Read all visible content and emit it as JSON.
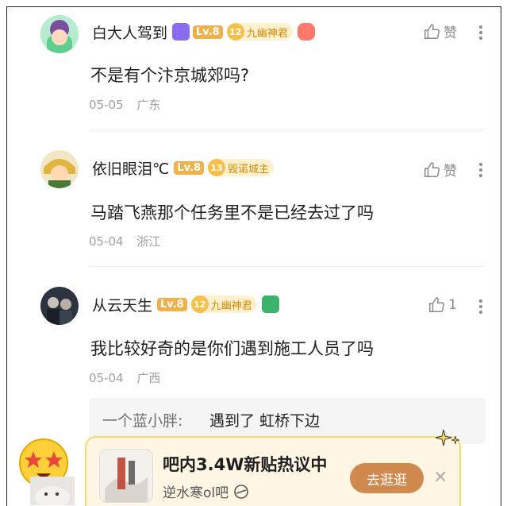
{
  "comments": [
    {
      "username": "白大人驾到",
      "level": "Lv.8",
      "rank_num": "12",
      "rank_title": "九幽神君",
      "like_label": "赞",
      "content": "不是有个汴京城郊吗?",
      "date": "05-05",
      "location": "广东"
    },
    {
      "username": "依旧眼泪℃",
      "level": "Lv.8",
      "rank_num": "13",
      "rank_title": "毁诺城主",
      "like_label": "赞",
      "content": "马踏飞燕那个任务里不是已经去过了吗",
      "date": "05-04",
      "location": "浙江"
    },
    {
      "username": "从云天生",
      "level": "Lv.8",
      "rank_num": "12",
      "rank_title": "九幽神君",
      "like_label": "1",
      "content": "我比较好奇的是你们遇到施工人员了吗",
      "date": "05-04",
      "location": "广西"
    }
  ],
  "reply": {
    "author": "一个蓝小胖:",
    "text": "遇到了 虹桥下边"
  },
  "popup": {
    "title": "吧内3.4W新贴热议中",
    "forum": "逆水寒ol吧",
    "button_label": "去逛逛",
    "close_label": "✕"
  },
  "colors": {
    "accent_orange": "#d08a50",
    "level_badge": "#f0b04a",
    "meta_gray": "#a0a0a0"
  }
}
